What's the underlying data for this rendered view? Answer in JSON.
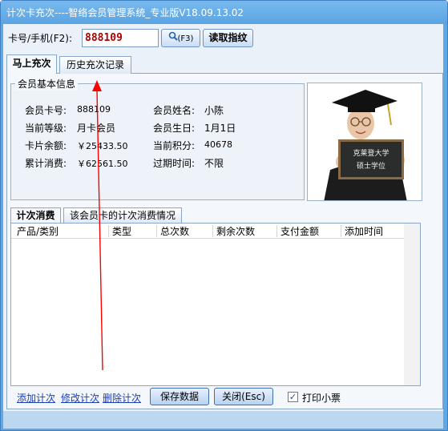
{
  "window": {
    "title": "计次卡充次----智络会员管理系统_专业版V18.09.13.02"
  },
  "search": {
    "label": "卡号/手机(F2):",
    "value": "888109",
    "search_button": "(F3)",
    "read_fingerprint_button": "读取指纹"
  },
  "tabs": {
    "recharge": "马上充次",
    "history": "历史充次记录"
  },
  "member_info": {
    "group_title": "会员基本信息",
    "fields": [
      {
        "label": "会员卡号:",
        "value": "888109"
      },
      {
        "label": "会员姓名:",
        "value": "小陈"
      },
      {
        "label": "当前等级:",
        "value": "月卡会员"
      },
      {
        "label": "会员生日:",
        "value": "1月1日"
      },
      {
        "label": "卡片余额:",
        "value": "￥25433.50"
      },
      {
        "label": "当前积分:",
        "value": "40678"
      },
      {
        "label": "累计消费:",
        "value": "￥62561.50"
      },
      {
        "label": "过期时间:",
        "value": "不限"
      }
    ]
  },
  "photo": {
    "sign_line1": "克莱登大学",
    "sign_line2": "硕士学位"
  },
  "lower_tabs": {
    "count_consume": "计次消费",
    "card_consume_detail": "该会员卡的计次消费情况"
  },
  "grid": {
    "columns": [
      "产品/类别",
      "类型",
      "总次数",
      "剩余次数",
      "支付金额",
      "添加时间"
    ]
  },
  "actions": {
    "add_link": "添加计次",
    "edit_link": "修改计次",
    "delete_link": "删除计次",
    "save_button": "保存数据",
    "close_button": "关闭(Esc)",
    "print_receipt_label": "打印小票",
    "print_receipt_checked": true
  },
  "colors": {
    "title_bar": "#5ea8e6",
    "card_value": "#b00000",
    "link": "#1a3fb8",
    "arrow": "#ff0000"
  }
}
